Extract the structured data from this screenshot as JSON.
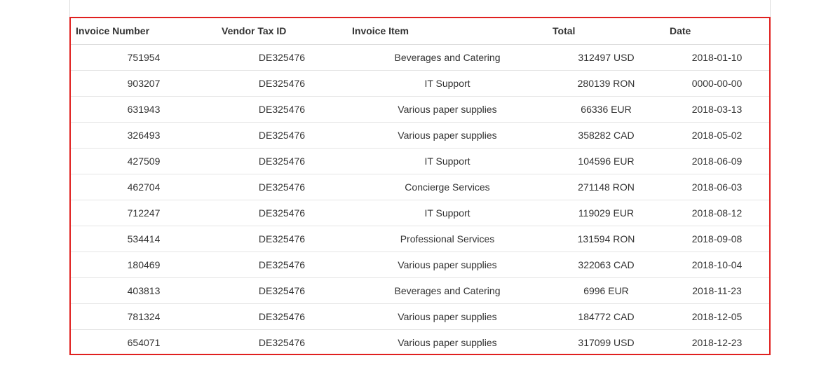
{
  "table": {
    "headers": [
      "Invoice Number",
      "Vendor Tax ID",
      "Invoice Item",
      "Total",
      "Date"
    ],
    "rows": [
      [
        "751954",
        "DE325476",
        "Beverages and Catering",
        "312497 USD",
        "2018-01-10"
      ],
      [
        "903207",
        "DE325476",
        "IT Support",
        "280139 RON",
        "0000-00-00"
      ],
      [
        "631943",
        "DE325476",
        "Various paper supplies",
        "66336 EUR",
        "2018-03-13"
      ],
      [
        "326493",
        "DE325476",
        "Various paper supplies",
        "358282 CAD",
        "2018-05-02"
      ],
      [
        "427509",
        "DE325476",
        "IT Support",
        "104596 EUR",
        "2018-06-09"
      ],
      [
        "462704",
        "DE325476",
        "Concierge Services",
        "271148 RON",
        "2018-06-03"
      ],
      [
        "712247",
        "DE325476",
        "IT Support",
        "119029 EUR",
        "2018-08-12"
      ],
      [
        "534414",
        "DE325476",
        "Professional Services",
        "131594 RON",
        "2018-09-08"
      ],
      [
        "180469",
        "DE325476",
        "Various paper supplies",
        "322063 CAD",
        "2018-10-04"
      ],
      [
        "403813",
        "DE325476",
        "Beverages and Catering",
        "6996 EUR",
        "2018-11-23"
      ],
      [
        "781324",
        "DE325476",
        "Various paper supplies",
        "184772 CAD",
        "2018-12-05"
      ],
      [
        "654071",
        "DE325476",
        "Various paper supplies",
        "317099 USD",
        "2018-12-23"
      ]
    ]
  },
  "colors": {
    "highlight_border": "#e0201f",
    "row_divider": "#e4e4e4",
    "text": "#333333"
  }
}
